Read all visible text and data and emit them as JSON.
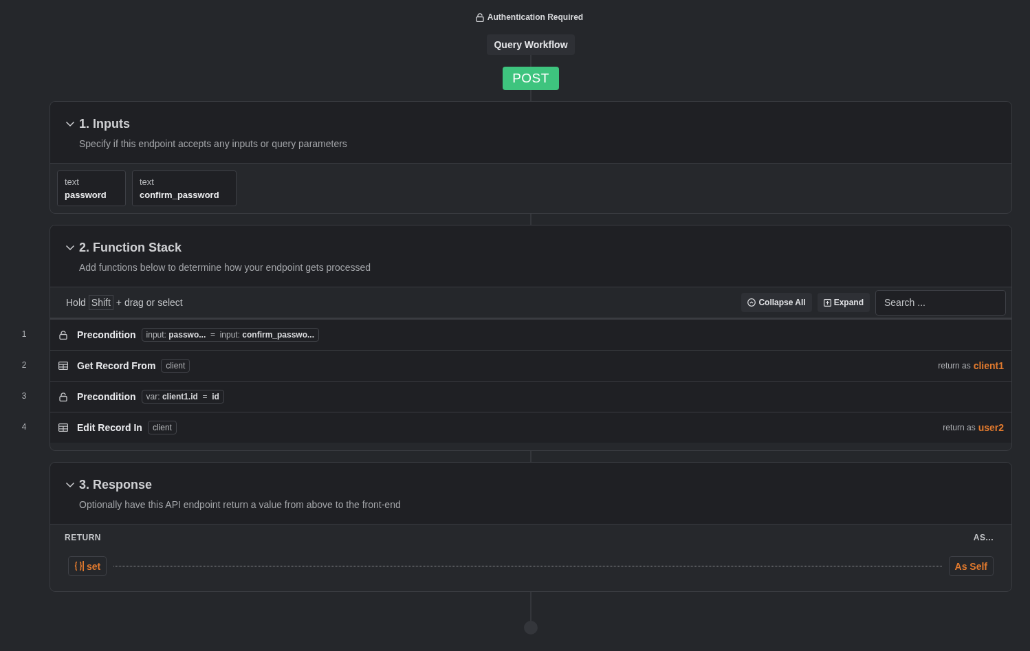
{
  "auth": {
    "label": "Authentication Required"
  },
  "workflow": {
    "title": "Query Workflow",
    "method": "POST"
  },
  "sections": [
    {
      "kind": "inputs",
      "title": "1. Inputs",
      "description": "Specify if this endpoint accepts any inputs or query parameters",
      "expanded": true,
      "inputs": [
        {
          "type": "text",
          "name": "password"
        },
        {
          "type": "text",
          "name": "confirm_password"
        }
      ]
    },
    {
      "kind": "stack",
      "title": "2. Function Stack",
      "description": "Add functions below to determine how your endpoint gets processed",
      "expanded": true,
      "hint": {
        "before": "Hold",
        "key": "Shift",
        "after": "+ drag or select"
      },
      "collapse_button": "Collapse All",
      "expand_button": "Expand",
      "search": {
        "placeholder": "Search ..."
      },
      "steps": [
        {
          "number": "1",
          "kind": "precondition",
          "name": "Precondition",
          "chip": "input: **passwo...**  =  input: **confirm_passwo...**"
        },
        {
          "number": "2",
          "kind": "record",
          "name": "Get Record From",
          "chip": "client",
          "return_label": "return as",
          "return_var": "client1"
        },
        {
          "number": "3",
          "kind": "precondition",
          "name": "Precondition",
          "chip": "var: **client1.id**  =  **id**"
        },
        {
          "number": "4",
          "kind": "record",
          "name": "Edit Record In",
          "chip": "client",
          "return_label": "return as",
          "return_var": "user2"
        }
      ]
    },
    {
      "kind": "response",
      "title": "3. Response",
      "description": "Optionally have this API endpoint return a value from above to the front-end",
      "expanded": true,
      "return_heading": "RETURN",
      "as_heading": "AS...",
      "return_value": "set",
      "as_value": "As Self"
    }
  ]
}
